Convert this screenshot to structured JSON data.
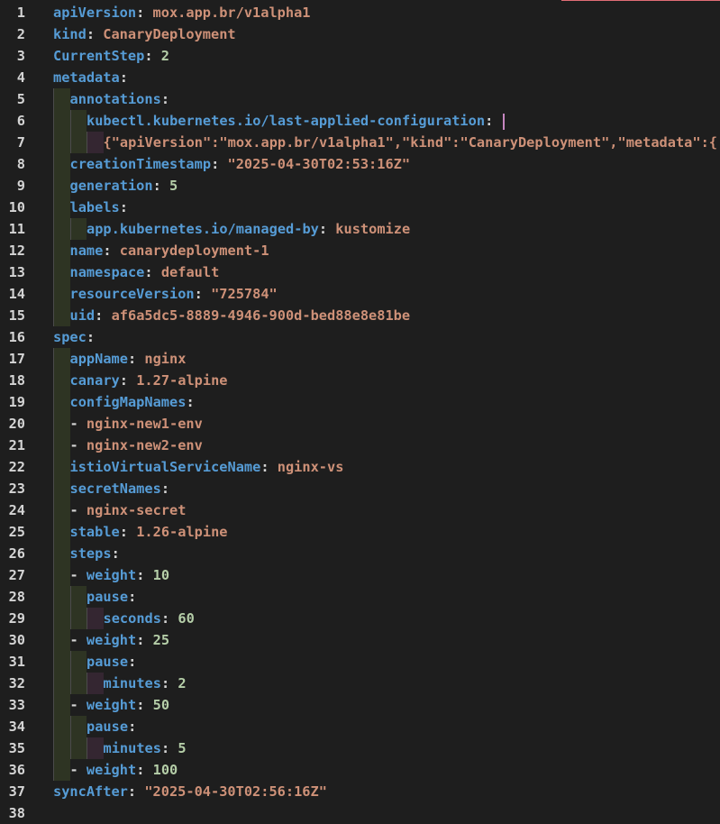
{
  "editor": {
    "colors": {
      "background": "#1e1e1e",
      "key": "#569cd6",
      "string": "#ce9178",
      "number": "#b5cea8",
      "punctuation": "#d4d4d4",
      "cursor": "#c586c0"
    },
    "lines": [
      {
        "num": "1",
        "indent": 0,
        "tokens": [
          {
            "t": "k",
            "v": "apiVersion"
          },
          {
            "t": "p",
            "v": ": "
          },
          {
            "t": "s",
            "v": "mox.app.br/v1alpha1"
          }
        ]
      },
      {
        "num": "2",
        "indent": 0,
        "tokens": [
          {
            "t": "k",
            "v": "kind"
          },
          {
            "t": "p",
            "v": ": "
          },
          {
            "t": "s",
            "v": "CanaryDeployment"
          }
        ]
      },
      {
        "num": "3",
        "indent": 0,
        "tokens": [
          {
            "t": "k",
            "v": "CurrentStep"
          },
          {
            "t": "p",
            "v": ": "
          },
          {
            "t": "n",
            "v": "2"
          }
        ]
      },
      {
        "num": "4",
        "indent": 0,
        "tokens": [
          {
            "t": "k",
            "v": "metadata"
          },
          {
            "t": "p",
            "v": ":"
          }
        ]
      },
      {
        "num": "5",
        "indent": 1,
        "tokens": [
          {
            "t": "k",
            "v": "annotations"
          },
          {
            "t": "p",
            "v": ":"
          }
        ]
      },
      {
        "num": "6",
        "indent": 2,
        "cursor": true,
        "tokens": [
          {
            "t": "k",
            "v": "kubectl.kubernetes.io/last-applied-configuration"
          },
          {
            "t": "p",
            "v": ": "
          }
        ]
      },
      {
        "num": "7",
        "indent": 3,
        "tokens": [
          {
            "t": "s",
            "v": "{\"apiVersion\":\"mox.app.br/v1alpha1\",\"kind\":\"CanaryDeployment\",\"metadata\":{"
          }
        ]
      },
      {
        "num": "8",
        "indent": 1,
        "tokens": [
          {
            "t": "k",
            "v": "creationTimestamp"
          },
          {
            "t": "p",
            "v": ": "
          },
          {
            "t": "s",
            "v": "\"2025-04-30T02:53:16Z\""
          }
        ]
      },
      {
        "num": "9",
        "indent": 1,
        "tokens": [
          {
            "t": "k",
            "v": "generation"
          },
          {
            "t": "p",
            "v": ": "
          },
          {
            "t": "n",
            "v": "5"
          }
        ]
      },
      {
        "num": "10",
        "indent": 1,
        "tokens": [
          {
            "t": "k",
            "v": "labels"
          },
          {
            "t": "p",
            "v": ":"
          }
        ]
      },
      {
        "num": "11",
        "indent": 2,
        "tokens": [
          {
            "t": "k",
            "v": "app.kubernetes.io/managed-by"
          },
          {
            "t": "p",
            "v": ": "
          },
          {
            "t": "s",
            "v": "kustomize"
          }
        ]
      },
      {
        "num": "12",
        "indent": 1,
        "tokens": [
          {
            "t": "k",
            "v": "name"
          },
          {
            "t": "p",
            "v": ": "
          },
          {
            "t": "s",
            "v": "canarydeployment-1"
          }
        ]
      },
      {
        "num": "13",
        "indent": 1,
        "tokens": [
          {
            "t": "k",
            "v": "namespace"
          },
          {
            "t": "p",
            "v": ": "
          },
          {
            "t": "s",
            "v": "default"
          }
        ]
      },
      {
        "num": "14",
        "indent": 1,
        "tokens": [
          {
            "t": "k",
            "v": "resourceVersion"
          },
          {
            "t": "p",
            "v": ": "
          },
          {
            "t": "s",
            "v": "\"725784\""
          }
        ]
      },
      {
        "num": "15",
        "indent": 1,
        "tokens": [
          {
            "t": "k",
            "v": "uid"
          },
          {
            "t": "p",
            "v": ": "
          },
          {
            "t": "s",
            "v": "af6a5dc5-8889-4946-900d-bed88e8e81be"
          }
        ]
      },
      {
        "num": "16",
        "indent": 0,
        "tokens": [
          {
            "t": "k",
            "v": "spec"
          },
          {
            "t": "p",
            "v": ":"
          }
        ]
      },
      {
        "num": "17",
        "indent": 1,
        "tokens": [
          {
            "t": "k",
            "v": "appName"
          },
          {
            "t": "p",
            "v": ": "
          },
          {
            "t": "s",
            "v": "nginx"
          }
        ]
      },
      {
        "num": "18",
        "indent": 1,
        "tokens": [
          {
            "t": "k",
            "v": "canary"
          },
          {
            "t": "p",
            "v": ": "
          },
          {
            "t": "s",
            "v": "1.27-alpine"
          }
        ]
      },
      {
        "num": "19",
        "indent": 1,
        "tokens": [
          {
            "t": "k",
            "v": "configMapNames"
          },
          {
            "t": "p",
            "v": ":"
          }
        ]
      },
      {
        "num": "20",
        "indent": 1,
        "tokens": [
          {
            "t": "p",
            "v": "- "
          },
          {
            "t": "s",
            "v": "nginx-new1-env"
          }
        ]
      },
      {
        "num": "21",
        "indent": 1,
        "tokens": [
          {
            "t": "p",
            "v": "- "
          },
          {
            "t": "s",
            "v": "nginx-new2-env"
          }
        ]
      },
      {
        "num": "22",
        "indent": 1,
        "tokens": [
          {
            "t": "k",
            "v": "istioVirtualServiceName"
          },
          {
            "t": "p",
            "v": ": "
          },
          {
            "t": "s",
            "v": "nginx-vs"
          }
        ]
      },
      {
        "num": "23",
        "indent": 1,
        "tokens": [
          {
            "t": "k",
            "v": "secretNames"
          },
          {
            "t": "p",
            "v": ":"
          }
        ]
      },
      {
        "num": "24",
        "indent": 1,
        "tokens": [
          {
            "t": "p",
            "v": "- "
          },
          {
            "t": "s",
            "v": "nginx-secret"
          }
        ]
      },
      {
        "num": "25",
        "indent": 1,
        "tokens": [
          {
            "t": "k",
            "v": "stable"
          },
          {
            "t": "p",
            "v": ": "
          },
          {
            "t": "s",
            "v": "1.26-alpine"
          }
        ]
      },
      {
        "num": "26",
        "indent": 1,
        "tokens": [
          {
            "t": "k",
            "v": "steps"
          },
          {
            "t": "p",
            "v": ":"
          }
        ]
      },
      {
        "num": "27",
        "indent": 1,
        "tokens": [
          {
            "t": "p",
            "v": "- "
          },
          {
            "t": "k",
            "v": "weight"
          },
          {
            "t": "p",
            "v": ": "
          },
          {
            "t": "n",
            "v": "10"
          }
        ]
      },
      {
        "num": "28",
        "indent": 2,
        "tokens": [
          {
            "t": "k",
            "v": "pause"
          },
          {
            "t": "p",
            "v": ":"
          }
        ]
      },
      {
        "num": "29",
        "indent": 3,
        "tokens": [
          {
            "t": "k",
            "v": "seconds"
          },
          {
            "t": "p",
            "v": ": "
          },
          {
            "t": "n",
            "v": "60"
          }
        ]
      },
      {
        "num": "30",
        "indent": 1,
        "tokens": [
          {
            "t": "p",
            "v": "- "
          },
          {
            "t": "k",
            "v": "weight"
          },
          {
            "t": "p",
            "v": ": "
          },
          {
            "t": "n",
            "v": "25"
          }
        ]
      },
      {
        "num": "31",
        "indent": 2,
        "tokens": [
          {
            "t": "k",
            "v": "pause"
          },
          {
            "t": "p",
            "v": ":"
          }
        ]
      },
      {
        "num": "32",
        "indent": 3,
        "tokens": [
          {
            "t": "k",
            "v": "minutes"
          },
          {
            "t": "p",
            "v": ": "
          },
          {
            "t": "n",
            "v": "2"
          }
        ]
      },
      {
        "num": "33",
        "indent": 1,
        "tokens": [
          {
            "t": "p",
            "v": "- "
          },
          {
            "t": "k",
            "v": "weight"
          },
          {
            "t": "p",
            "v": ": "
          },
          {
            "t": "n",
            "v": "50"
          }
        ]
      },
      {
        "num": "34",
        "indent": 2,
        "tokens": [
          {
            "t": "k",
            "v": "pause"
          },
          {
            "t": "p",
            "v": ":"
          }
        ]
      },
      {
        "num": "35",
        "indent": 3,
        "tokens": [
          {
            "t": "k",
            "v": "minutes"
          },
          {
            "t": "p",
            "v": ": "
          },
          {
            "t": "n",
            "v": "5"
          }
        ]
      },
      {
        "num": "36",
        "indent": 1,
        "tokens": [
          {
            "t": "p",
            "v": "- "
          },
          {
            "t": "k",
            "v": "weight"
          },
          {
            "t": "p",
            "v": ": "
          },
          {
            "t": "n",
            "v": "100"
          }
        ]
      },
      {
        "num": "37",
        "indent": 0,
        "tokens": [
          {
            "t": "k",
            "v": "syncAfter"
          },
          {
            "t": "p",
            "v": ": "
          },
          {
            "t": "s",
            "v": "\"2025-04-30T02:56:16Z\""
          }
        ]
      },
      {
        "num": "38",
        "indent": 0,
        "tokens": []
      }
    ]
  }
}
